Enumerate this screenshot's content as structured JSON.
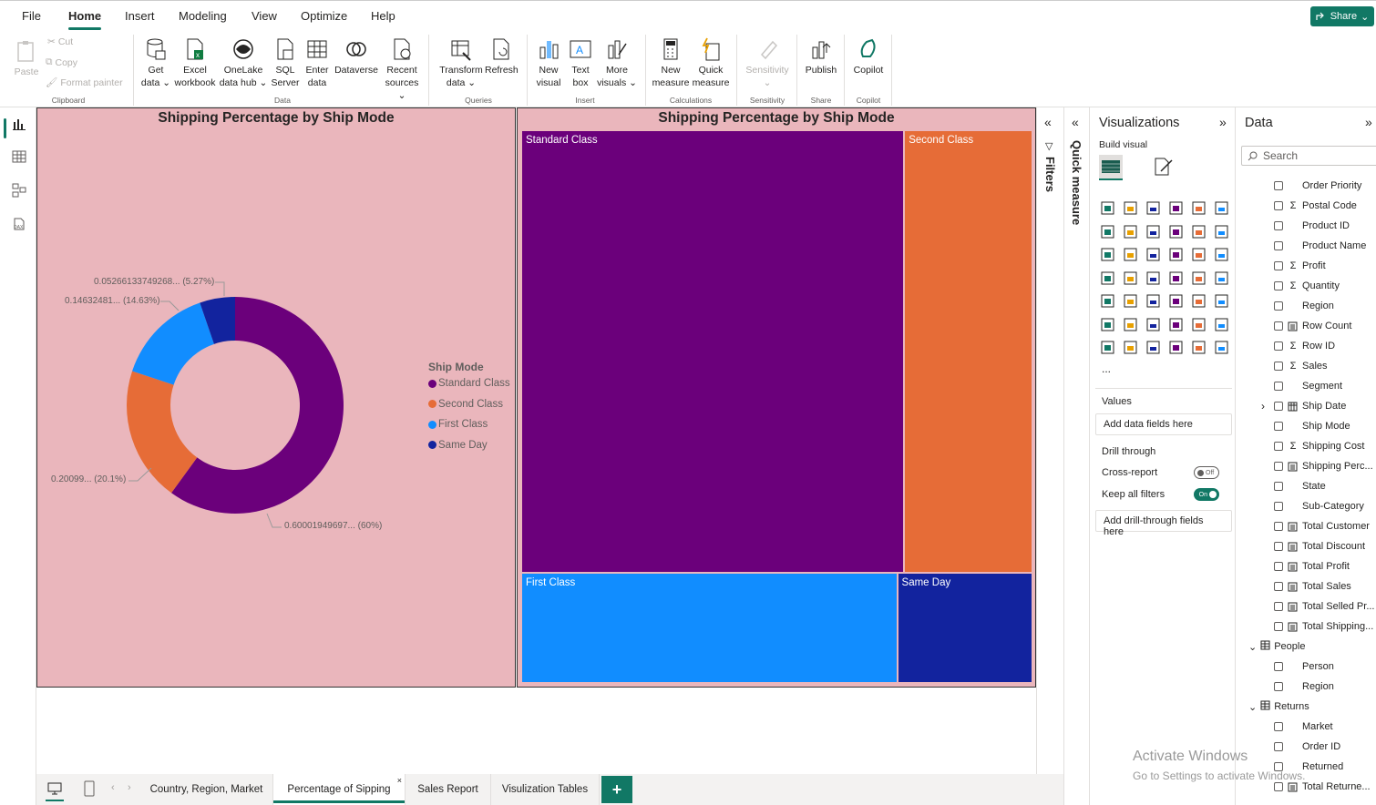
{
  "menu": {
    "items": [
      "File",
      "Home",
      "Insert",
      "Modeling",
      "View",
      "Optimize",
      "Help"
    ],
    "active": "Home",
    "share_label": "Share"
  },
  "ribbon": {
    "clipboard": {
      "paste": "Paste",
      "cut": "Cut",
      "copy": "Copy",
      "format_painter": "Format painter",
      "group": "Clipboard"
    },
    "data": {
      "get_data": [
        "Get",
        "data ⌄"
      ],
      "excel": [
        "Excel",
        "workbook"
      ],
      "onelake": [
        "OneLake",
        "data hub ⌄"
      ],
      "sql": [
        "SQL",
        "Server"
      ],
      "enter": [
        "Enter",
        "data"
      ],
      "dataverse": [
        "Dataverse",
        ""
      ],
      "recent": [
        "Recent",
        "sources ⌄"
      ],
      "group": "Data"
    },
    "queries": {
      "transform": [
        "Transform",
        "data ⌄"
      ],
      "refresh": [
        "Refresh",
        ""
      ],
      "group": "Queries"
    },
    "insert": {
      "new_visual": [
        "New",
        "visual"
      ],
      "text_box": [
        "Text",
        "box"
      ],
      "more_visuals": [
        "More",
        "visuals ⌄"
      ],
      "group": "Insert"
    },
    "calculations": {
      "new_measure": [
        "New",
        "measure"
      ],
      "quick_measure": [
        "Quick",
        "measure"
      ],
      "group": "Calculations"
    },
    "sensitivity": {
      "label": [
        "Sensitivity",
        "⌄"
      ],
      "group": "Sensitivity"
    },
    "share": {
      "publish": [
        "Publish",
        ""
      ],
      "group": "Share"
    },
    "copilot": {
      "label": [
        "Copilot",
        ""
      ],
      "group": "Copilot"
    }
  },
  "visual_donut": {
    "title": "Shipping Percentage by Ship Mode",
    "legend_title": "Ship Mode",
    "labels": {
      "same_day": "0.05266133749268... (5.27%)",
      "first_class": "0.14632481... (14.63%)",
      "second_class": "0.20099... (20.1%)",
      "standard_class": "0.60001949697... (60%)"
    }
  },
  "visual_treemap": {
    "title": "Shipping Percentage by Ship Mode"
  },
  "chart_data": [
    {
      "type": "pie",
      "title": "Shipping Percentage by Ship Mode",
      "legend_title": "Ship Mode",
      "categories": [
        "Standard Class",
        "Second Class",
        "First Class",
        "Same Day"
      ],
      "values": [
        0.60001949697,
        0.20099,
        0.14632481,
        0.05266133749268
      ],
      "colors": [
        "#6b007b",
        "#e66c37",
        "#118dff",
        "#12239e"
      ],
      "legend_placement": "right"
    },
    {
      "type": "treemap",
      "title": "Shipping Percentage by Ship Mode",
      "categories": [
        "Standard Class",
        "Second Class",
        "First Class",
        "Same Day"
      ],
      "values": [
        0.60001949697,
        0.20099,
        0.14632481,
        0.05266133749268
      ],
      "colors": [
        "#6b007b",
        "#e66c37",
        "#118dff",
        "#12239e"
      ]
    }
  ],
  "filters": {
    "label": "Filters"
  },
  "quick_measure": {
    "label": "Quick measure"
  },
  "viz_pane": {
    "title": "Visualizations",
    "build_visual": "Build visual",
    "values_label": "Values",
    "values_placeholder": "Add data fields here",
    "drill_label": "Drill through",
    "cross_report": "Cross-report",
    "cross_state": "Off",
    "keep_filters": "Keep all filters",
    "keep_state": "On",
    "drill_placeholder": "Add drill-through fields here",
    "more": "..."
  },
  "data_pane": {
    "title": "Data",
    "search_placeholder": "Search",
    "fields": [
      {
        "label": "Order Priority",
        "sig": ""
      },
      {
        "label": "Postal Code",
        "sig": "sum"
      },
      {
        "label": "Product ID",
        "sig": ""
      },
      {
        "label": "Product Name",
        "sig": ""
      },
      {
        "label": "Profit",
        "sig": "sum"
      },
      {
        "label": "Quantity",
        "sig": "sum"
      },
      {
        "label": "Region",
        "sig": ""
      },
      {
        "label": "Row Count",
        "sig": "calc"
      },
      {
        "label": "Row ID",
        "sig": "sum"
      },
      {
        "label": "Sales",
        "sig": "sum"
      },
      {
        "label": "Segment",
        "sig": ""
      },
      {
        "label": "Ship Date",
        "sig": "date"
      },
      {
        "label": "Ship Mode",
        "sig": ""
      },
      {
        "label": "Shipping Cost",
        "sig": "sum"
      },
      {
        "label": "Shipping Perc...",
        "sig": "calc"
      },
      {
        "label": "State",
        "sig": ""
      },
      {
        "label": "Sub-Category",
        "sig": ""
      },
      {
        "label": "Total Customer",
        "sig": "calc"
      },
      {
        "label": "Total Discount",
        "sig": "calc"
      },
      {
        "label": "Total Profit",
        "sig": "calc"
      },
      {
        "label": "Total Sales",
        "sig": "calc"
      },
      {
        "label": "Total Selled Pr...",
        "sig": "calc"
      },
      {
        "label": "Total Shipping...",
        "sig": "calc"
      }
    ],
    "people_table": "People",
    "people_fields": [
      "Person",
      "Region"
    ],
    "returns_table": "Returns",
    "returns_fields": [
      "Market",
      "Order ID",
      "Returned"
    ],
    "returns_calc": "Total Returne..."
  },
  "tabs": {
    "pages": [
      "Country, Region, Market",
      "Percentage of Sipping",
      "Sales Report",
      "Visulization Tables"
    ],
    "active": "Percentage of Sipping",
    "add": "+"
  },
  "watermark": {
    "line1": "Activate Windows",
    "line2": "Go to Settings to activate Windows."
  }
}
